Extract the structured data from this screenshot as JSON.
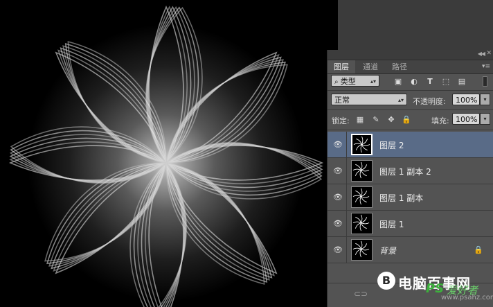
{
  "panel": {
    "tabs": [
      "图层",
      "通道",
      "路径"
    ],
    "filter": {
      "kind_label": "类型"
    },
    "blend_mode": "正常",
    "opacity": {
      "label": "不透明度:",
      "value": "100%"
    },
    "lock": {
      "label": "锁定:"
    },
    "fill": {
      "label": "填充:",
      "value": "100%"
    },
    "layers": [
      {
        "name": "图层 2",
        "selected": true
      },
      {
        "name": "图层 1 副本 2",
        "selected": false
      },
      {
        "name": "图层 1 副本",
        "selected": false
      },
      {
        "name": "图层 1",
        "selected": false
      },
      {
        "name": "背景",
        "selected": false,
        "locked": true
      }
    ]
  },
  "watermark": {
    "logo_letter": "B",
    "title": "电脑百事网",
    "ps_text": "PS",
    "love_text": "爱好者",
    "url": "www.psahz.com"
  },
  "colors": {
    "selected_layer": "#596b87",
    "panel_bg": "#535353",
    "watermark_green": "#3cb13c"
  }
}
